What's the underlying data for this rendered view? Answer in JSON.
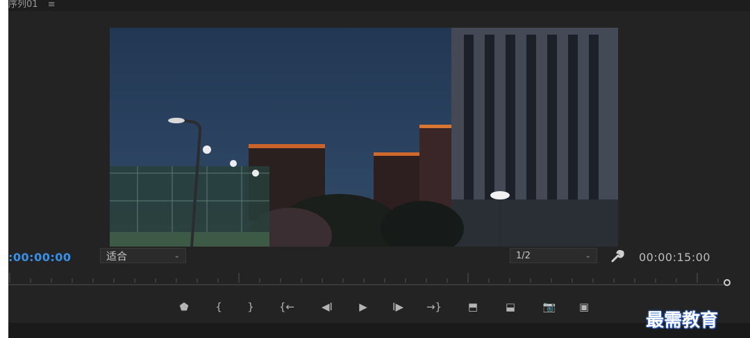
{
  "title_bar": {
    "text": "序列01",
    "menu_glyph": "≡"
  },
  "timecode_left": ":00:00:00",
  "fit_select": {
    "value": "适合",
    "chev": "⌄"
  },
  "resolution_select": {
    "value": "1/2",
    "chev": "⌄"
  },
  "timecode_right": "00:00:15:00",
  "transport": [
    {
      "name": "add-marker-button",
      "icon": "marker-icon",
      "glyph": "⬟"
    },
    {
      "name": "mark-in-button",
      "icon": "mark-in-icon",
      "glyph": "{"
    },
    {
      "name": "mark-out-button",
      "icon": "mark-out-icon",
      "glyph": "}"
    },
    {
      "name": "go-to-in-button",
      "icon": "go-to-in-icon",
      "glyph": "{←"
    },
    {
      "name": "step-back-button",
      "icon": "step-back-icon",
      "glyph": "◀I"
    },
    {
      "name": "play-button",
      "icon": "play-icon",
      "glyph": "▶"
    },
    {
      "name": "step-forward-button",
      "icon": "step-forward-icon",
      "glyph": "I▶"
    },
    {
      "name": "go-to-out-button",
      "icon": "go-to-out-icon",
      "glyph": "→}"
    },
    {
      "name": "lift-button",
      "icon": "lift-icon",
      "glyph": "⬒"
    },
    {
      "name": "extract-button",
      "icon": "extract-icon",
      "glyph": "⬓"
    },
    {
      "name": "export-frame-button",
      "icon": "camera-icon",
      "glyph": "📷"
    },
    {
      "name": "comparison-view-button",
      "icon": "comparison-icon",
      "glyph": "▣"
    }
  ],
  "watermark": "最需教育",
  "colors": {
    "timecode_accent": "#3d8fe0",
    "panel_bg": "#232323"
  }
}
